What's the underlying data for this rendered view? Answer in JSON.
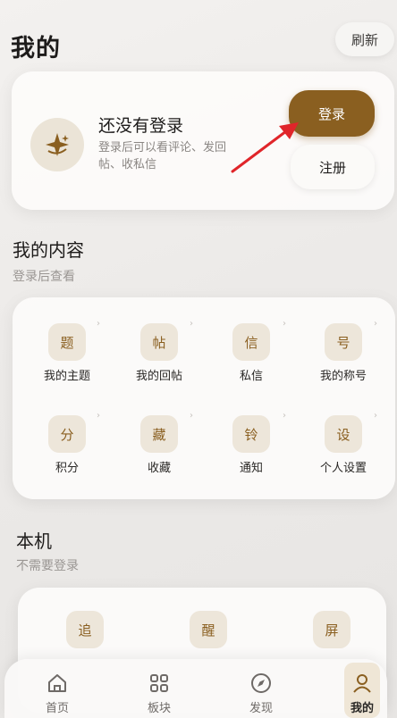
{
  "header": {
    "title": "我的",
    "refresh_label": "刷新"
  },
  "login_card": {
    "title": "还没有登录",
    "desc": "登录后可以看评论、发回帖、收私信",
    "login_label": "登录",
    "register_label": "注册"
  },
  "my_content": {
    "title": "我的内容",
    "subtitle": "登录后查看",
    "items": [
      {
        "icon_char": "题",
        "label": "我的主题"
      },
      {
        "icon_char": "帖",
        "label": "我的回帖"
      },
      {
        "icon_char": "信",
        "label": "私信"
      },
      {
        "icon_char": "号",
        "label": "我的称号"
      },
      {
        "icon_char": "分",
        "label": "积分"
      },
      {
        "icon_char": "藏",
        "label": "收藏"
      },
      {
        "icon_char": "铃",
        "label": "通知"
      },
      {
        "icon_char": "设",
        "label": "个人设置"
      }
    ]
  },
  "local": {
    "title": "本机",
    "subtitle": "不需要登录",
    "items": [
      {
        "icon_char": "追"
      },
      {
        "icon_char": "醒"
      },
      {
        "icon_char": "屏"
      }
    ]
  },
  "tabs": [
    {
      "label": "首页",
      "icon": "home-icon"
    },
    {
      "label": "板块",
      "icon": "grid-icon"
    },
    {
      "label": "发现",
      "icon": "compass-icon"
    },
    {
      "label": "我的",
      "icon": "person-icon",
      "active": true
    }
  ],
  "colors": {
    "accent": "#8a5f20",
    "icon_bg": "#ede6da",
    "arrow": "#e0252a"
  }
}
